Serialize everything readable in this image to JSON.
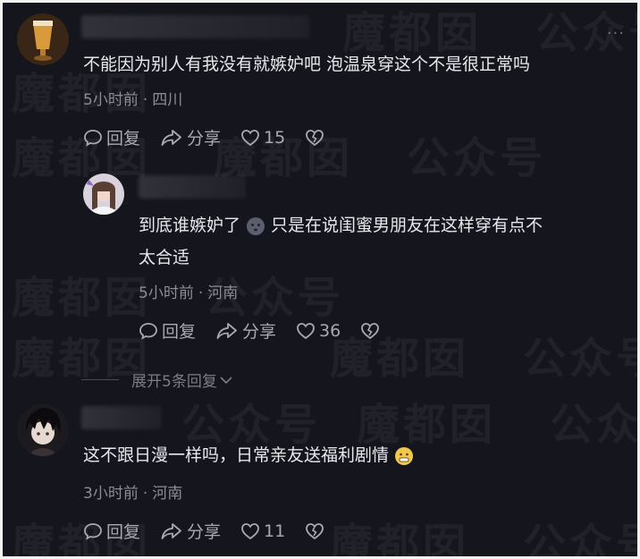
{
  "watermark": {
    "name": "魔都囡",
    "public": "公众号"
  },
  "more_icon": "more-dots-icon",
  "comments": [
    {
      "text": "不能因为别人有我没有就嫉妒吧 泡温泉穿这个不是很正常吗",
      "time": "5小时前",
      "location": "四川",
      "reply_label": "回复",
      "share_label": "分享",
      "likes": "15"
    },
    {
      "text_line1_a": "到底谁嫉妒了",
      "text_line1_b": "只是在说闺蜜男朋友在这样穿有点不",
      "text_line2": "太合适",
      "time": "5小时前",
      "location": "河南",
      "reply_label": "回复",
      "share_label": "分享",
      "likes": "36"
    },
    {
      "text": "这不跟日漫一样吗，日常亲友送福利剧情",
      "time": "3小时前",
      "location": "河南",
      "reply_label": "回复",
      "share_label": "分享",
      "likes": "11"
    }
  ],
  "expand_label": "展开5条回复",
  "colors": {
    "background": "#14151d",
    "text": "#e8e8ea",
    "meta": "#8c8d94"
  }
}
